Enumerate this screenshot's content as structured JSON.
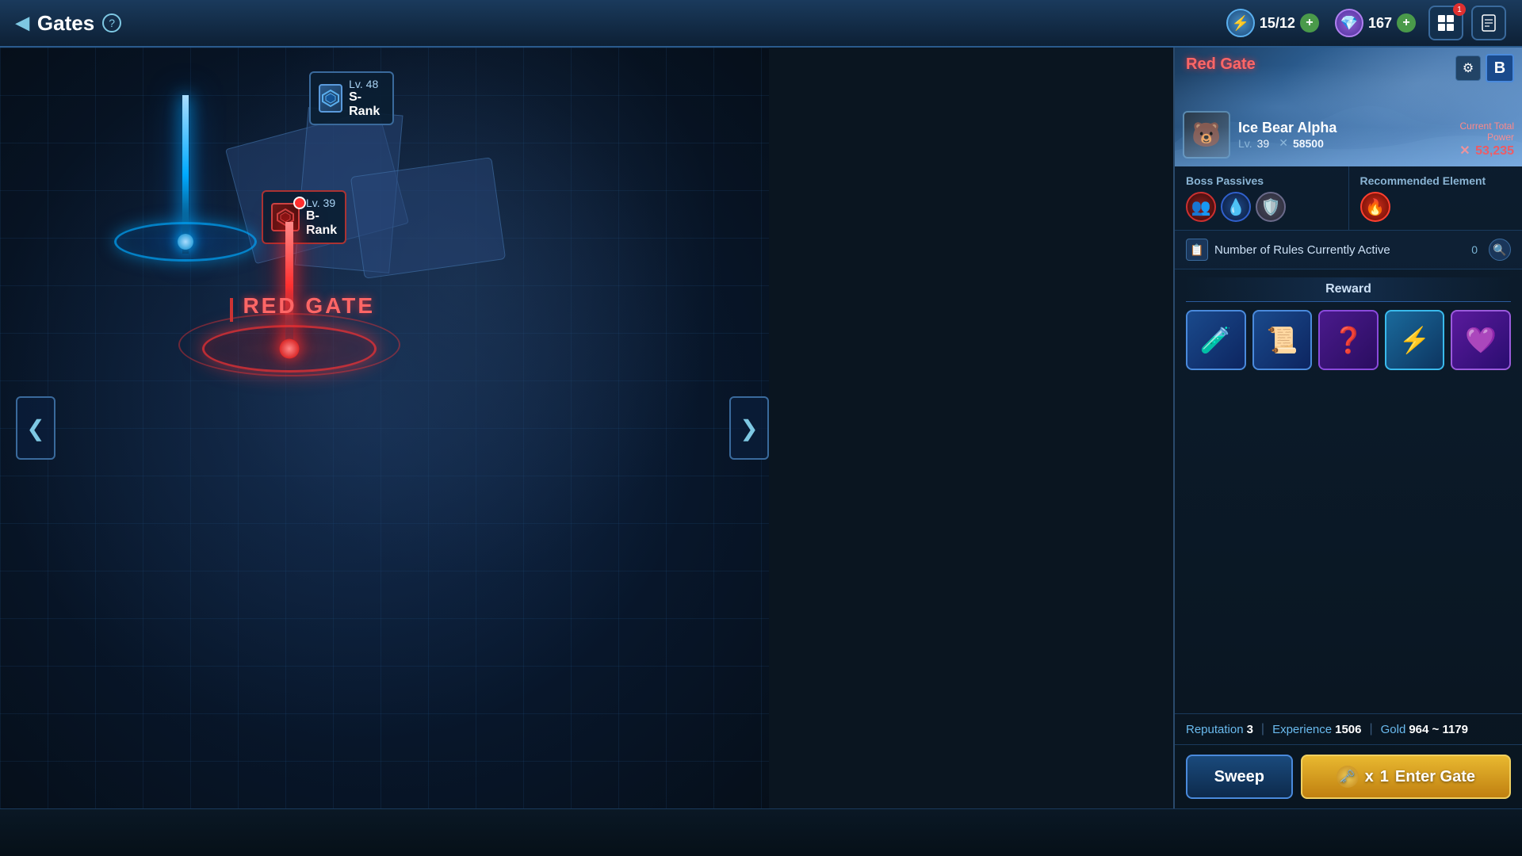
{
  "topbar": {
    "back_label": "◀",
    "title": "Gates",
    "help_label": "?",
    "stamina_current": "15",
    "stamina_max": "12",
    "stamina_separator": "/",
    "stamina_add": "+",
    "crystal_amount": "167",
    "crystal_add": "+",
    "notif_count": "1"
  },
  "map": {
    "blue_gate": {
      "level": "Lv. 48",
      "rank": "S-Rank"
    },
    "red_gate": {
      "level": "Lv. 39",
      "rank": "B-Rank",
      "label": "RED GATE"
    },
    "nav_left": "❮",
    "nav_right": "❯"
  },
  "panel": {
    "gate_title": "Red Gate",
    "gate_rank": "B",
    "boss": {
      "name": "Ice Bear Alpha",
      "level": "39",
      "power": "58500",
      "current_total_label": "Current Total",
      "power_label": "Power",
      "power_value": "53,235",
      "cross": "✕"
    },
    "passives": {
      "label": "Boss Passives",
      "icons": [
        "👥",
        "💧",
        "🛡️"
      ]
    },
    "recommended": {
      "label": "Recommended Element",
      "icon": "🔥"
    },
    "rules": {
      "icon": "📋",
      "text": "Number of Rules Currently Active",
      "count": "0",
      "search_icon": "🔍"
    },
    "reward": {
      "label": "Reward",
      "items": [
        {
          "icon": "🧪",
          "type": "default"
        },
        {
          "icon": "📜",
          "type": "default"
        },
        {
          "icon": "❓",
          "type": "purple"
        },
        {
          "icon": "⚡",
          "type": "light-blue"
        },
        {
          "icon": "💜",
          "type": "purple2"
        }
      ]
    },
    "stats": {
      "reputation_label": "Reputation",
      "reputation_value": "3",
      "experience_label": "Experience",
      "experience_value": "1506",
      "gold_label": "Gold",
      "gold_value": "964 ~ 1179"
    },
    "buttons": {
      "sweep": "Sweep",
      "enter_prefix": "x",
      "enter_count": "1",
      "enter": "Enter Gate"
    }
  },
  "colors": {
    "accent_blue": "#4a8adc",
    "accent_red": "#cc3333",
    "accent_gold": "#e8b830",
    "text_muted": "#8ab4d4",
    "panel_bg": "#0d1e30"
  }
}
